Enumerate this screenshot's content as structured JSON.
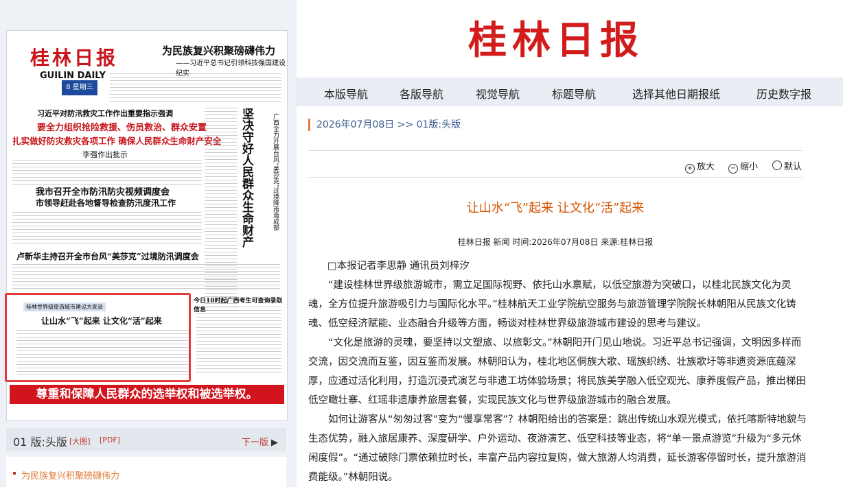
{
  "newspaper": {
    "logo": "桂林日报",
    "english_name": "GUILIN DAILY",
    "date_badge": "8 星期三",
    "banner_title": "为民族复兴积聚磅礴伟力",
    "banner_subtitle": "——习近平总书记引领科技强国建设纪实",
    "story1_kicker": "习近平对防汛救灾工作作出重要指示强调",
    "story1_head1": "要全力组织抢险救援、伤员救治、群众安置",
    "story1_head2": "扎实做好防灾救灾各项工作 确保人民群众生命财产安全",
    "story1_sub": "李强作出批示",
    "vertical_head": "坚决守好人民群众生命财产安全 全力以赴争分夺秒严防死守",
    "vertical_side": "广西全力开展台风“美莎克”过境降雨造成部分水库出现严重险情应急抢险工作",
    "story2_head": "我市召开全市防汛防灾视频调度会",
    "story2_sub": "市领导赶赴各地督导检查防汛度汛工作",
    "story3_head": "卢新华主持召开全市台风“美莎克”过境防汛调度会",
    "story4_kicker": "桂林世界级旅游城市建设大家谈",
    "story4_head": "让山水“飞”起来 让文化“活”起来",
    "story5_head": "今日18时起广西考生可查询录取信息",
    "red_banner": "尊重和保障人民群众的选举权和被选举权。"
  },
  "page_nav": {
    "page_label": "01 版:头版",
    "big_image": "[大图]",
    "pdf": "[PDF]",
    "next_page": "下一版"
  },
  "left_list": [
    "为民族复兴积聚磅礴伟力"
  ],
  "site": {
    "logo": "桂林日报",
    "nav": [
      "本版导航",
      "各版导航",
      "视觉导航",
      "标题导航",
      "选择其他日期报纸",
      "历史数字报"
    ]
  },
  "breadcrumb": "2026年07月08日 >> 01版:头版",
  "zoom": {
    "enlarge": "放大",
    "shrink": "缩小",
    "default": "默认"
  },
  "article": {
    "title": "让山水“飞”起来 让文化“活”起来",
    "meta": "桂林日报 新闻    时间:2026年07月08日    来源:桂林日报",
    "byline": "□本报记者李思静 通讯员刘梓汐",
    "paragraphs": [
      "“建设桂林世界级旅游城市，需立足国际视野、依托山水禀赋，以低空旅游为突破口，以桂北民族文化为灵魂，全方位提升旅游吸引力与国际化水平。”桂林航天工业学院航空服务与旅游管理学院院长林朝阳从民族文化铸魂、低空经济赋能、业态融合升级等方面，畅谈对桂林世界级旅游城市建设的思考与建议。",
      "“文化是旅游的灵魂，要坚持以文塑旅、以旅彰文。”林朝阳开门见山地说。习近平总书记强调，文明因多样而交流，因交流而互鉴，因互鉴而发展。林朝阳认为，桂北地区侗族大歌、瑶族织绣、壮族歌圩等非遗资源底蕴深厚，应通过活化利用，打造沉浸式演艺与非遗工坊体验场景；将民族美学融入低空观光、康养度假产品，推出梯田低空瞰壮寨、红瑶非遗康养旅居套餐，实现民族文化与世界级旅游城市的融合发展。",
      "如何让游客从“匆匆过客”变为“慢享常客”？林朝阳给出的答案是：跳出传统山水观光模式，依托喀斯特地貌与生态优势，融入旅居康养、深度研学、户外运动、夜游演艺、低空科技等业态，将“单一景点游览”升级为“多元休闲度假”。“通过破除门票依赖拉时长，丰富产品内容拉复购，做大旅游人均消费，延长游客停留时长，提升旅游消费能级。”林朝阳说。"
    ]
  }
}
